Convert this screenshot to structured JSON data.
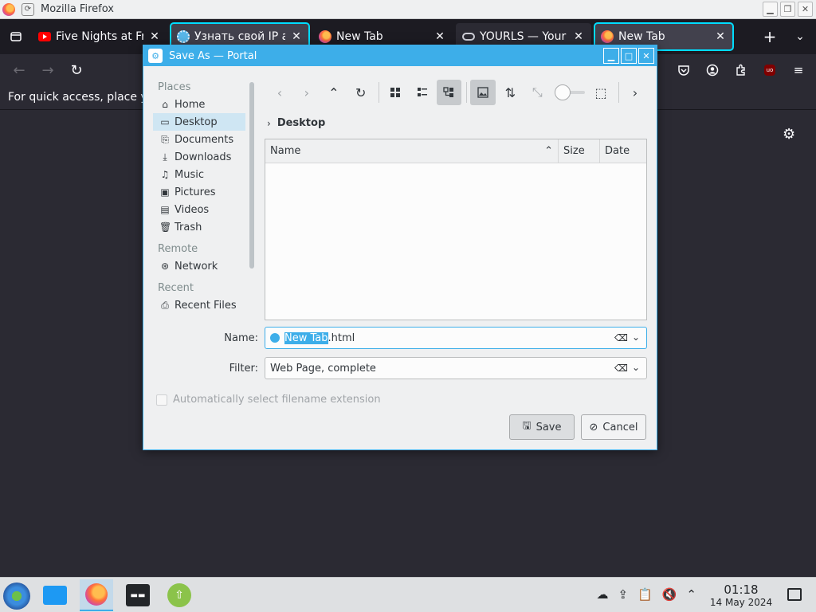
{
  "window": {
    "title": "Mozilla Firefox"
  },
  "tabs": [
    {
      "label": "Five Nights at Fred",
      "favicon": "youtube-icon",
      "state": "normal"
    },
    {
      "label": "Узнать свой IP ад",
      "favicon": "gear-favicon",
      "state": "active-outlined"
    },
    {
      "label": "New Tab",
      "favicon": "firefox-icon",
      "state": "normal"
    },
    {
      "label": "YOURLS — Your O",
      "favicon": "link-icon",
      "state": "grey"
    },
    {
      "label": "New Tab",
      "favicon": "firefox-icon",
      "state": "active"
    }
  ],
  "bookmarks_hint": "For quick access, place yo",
  "dialog": {
    "title": "Save As — Portal",
    "places_section": "Places",
    "places": [
      {
        "label": "Home",
        "icon": "home-icon",
        "selected": false
      },
      {
        "label": "Desktop",
        "icon": "desktop-icon",
        "selected": true
      },
      {
        "label": "Documents",
        "icon": "documents-icon",
        "selected": false
      },
      {
        "label": "Downloads",
        "icon": "downloads-icon",
        "selected": false
      },
      {
        "label": "Music",
        "icon": "music-icon",
        "selected": false
      },
      {
        "label": "Pictures",
        "icon": "pictures-icon",
        "selected": false
      },
      {
        "label": "Videos",
        "icon": "videos-icon",
        "selected": false
      },
      {
        "label": "Trash",
        "icon": "trash-icon",
        "selected": false
      }
    ],
    "remote_section": "Remote",
    "remote": [
      {
        "label": "Network",
        "icon": "network-icon"
      }
    ],
    "recent_section": "Recent",
    "recent": [
      {
        "label": "Recent Files",
        "icon": "recent-files-icon"
      }
    ],
    "breadcrumb": "Desktop",
    "columns": {
      "name": "Name",
      "size": "Size",
      "date": "Date"
    },
    "name_label": "Name:",
    "name_selected": "New Tab",
    "name_rest": ".html",
    "filter_label": "Filter:",
    "filter_value": "Web Page, complete",
    "auto_ext": "Automatically select filename extension",
    "save": "Save",
    "cancel": "Cancel"
  },
  "taskbar": {
    "time": "01:18",
    "date": "14 May 2024"
  },
  "colors": {
    "accent": "#3daee9",
    "firefox_dark": "#2b2a33"
  }
}
